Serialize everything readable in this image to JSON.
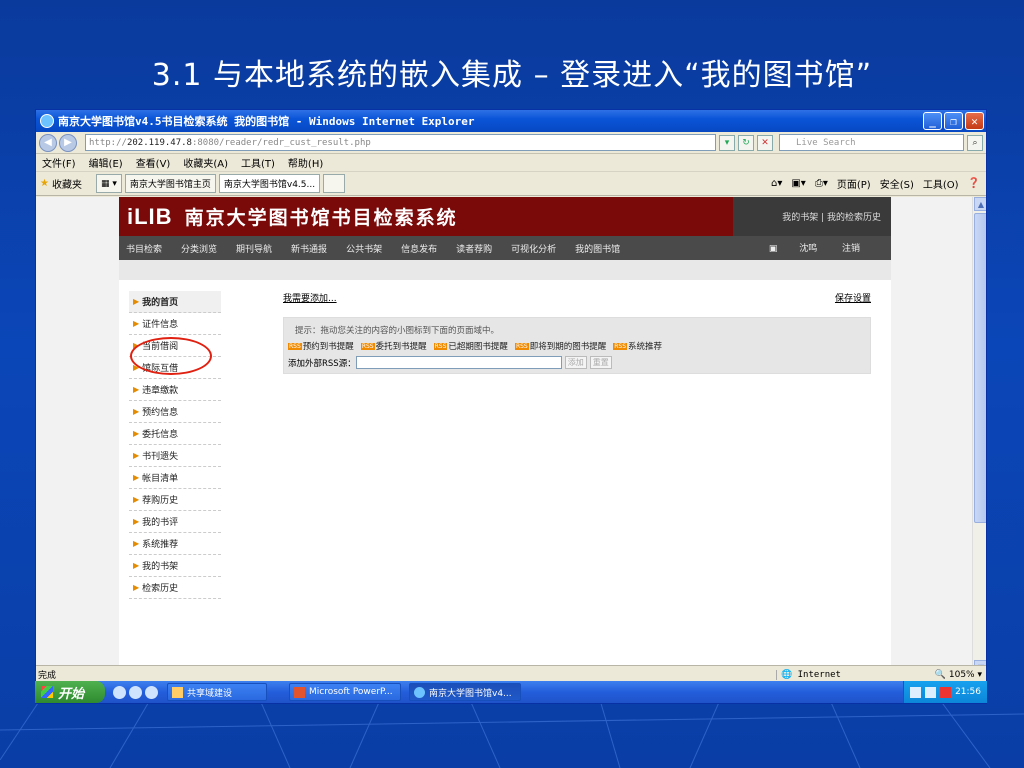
{
  "slide": {
    "title": "3.1 与本地系统的嵌入集成 – 登录进入“我的图书馆”"
  },
  "window": {
    "title": "南京大学图书馆v4.5书目检索系统 我的图书馆 - Windows Internet Explorer",
    "url_prefix": "http://",
    "url_host": "202.119.47.8",
    "url_rest": ":8080/reader/redr_cust_result.php",
    "search_placeholder": "Live Search",
    "menu": [
      "文件(F)",
      "编辑(E)",
      "查看(V)",
      "收藏夹(A)",
      "工具(T)",
      "帮助(H)"
    ],
    "favorites_label": "收藏夹",
    "tabs": [
      "南京大学图书馆主页",
      "南京大学图书馆v4.5..."
    ],
    "tools": [
      "页面(P)",
      "安全(S)",
      "工具(O)"
    ],
    "status_done": "完成",
    "status_zone": "Internet",
    "status_zoom": "105%"
  },
  "site": {
    "logo": "iLIB",
    "title": "南京大学图书馆书目检索系统",
    "head_right": "我的书架 | 我的检索历史",
    "nav": [
      "书目检索",
      "分类浏览",
      "期刊导航",
      "新书通报",
      "公共书架",
      "信息发布",
      "读者荐购",
      "可视化分析",
      "我的图书馆"
    ],
    "user": "沈鸣",
    "logout": "注销",
    "side_items": [
      "我的首页",
      "证件信息",
      "当前借阅",
      "馆际互借",
      "违章缴款",
      "预约信息",
      "委托信息",
      "书刊遗失",
      "帐目清单",
      "荐购历史",
      "我的书评",
      "系统推荐",
      "我的书架",
      "检索历史"
    ],
    "add_link": "我需要添加...",
    "save_link": "保存设置",
    "hint": "提示：拖动您关注的内容的小图标到下面的页面域中。",
    "feeds": [
      "预约到书提醒",
      "委托到书提醒",
      "已超期图书提醒",
      "即将到期的图书提醒",
      "系统推荐"
    ],
    "rss_label": "添加外部RSS源：",
    "rss_add": "添加",
    "rss_reset": "重置"
  },
  "taskbar": {
    "start": "开始",
    "buttons": [
      "共享域建设",
      "Microsoft PowerP...",
      "南京大学图书馆v4..."
    ],
    "time": "21:56"
  }
}
